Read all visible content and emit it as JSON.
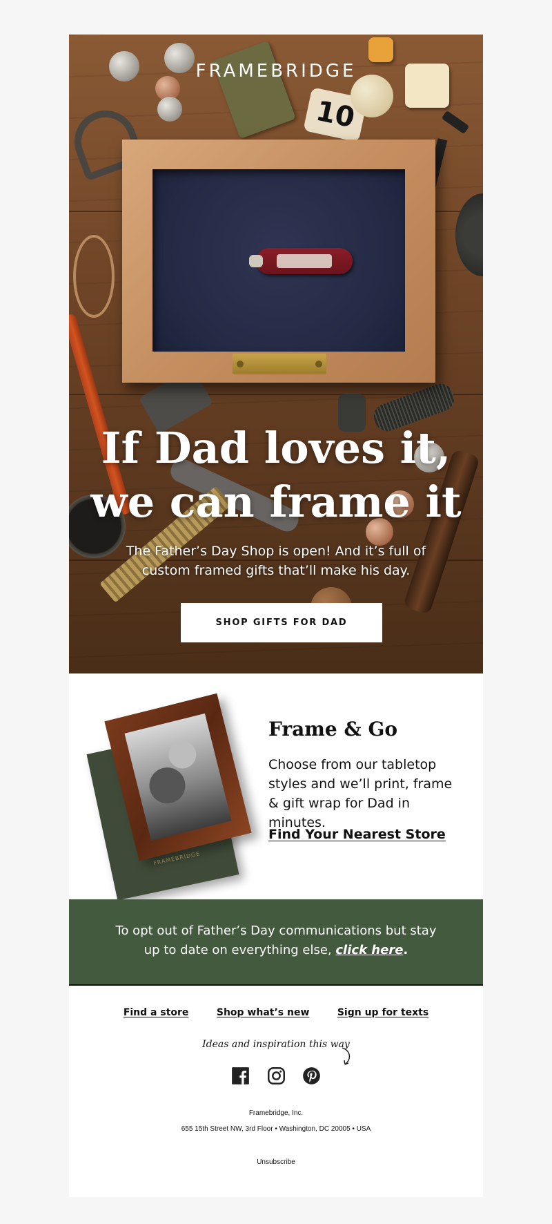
{
  "hero": {
    "logo": "FRAMEBRIDGE",
    "tag_number": "10",
    "headline_line1": "If Dad loves it,",
    "headline_line2": "we can frame it",
    "subtext": "The Father’s Day Shop is open! And it’s full of custom framed gifts that’ll make his day.",
    "cta_label": "SHOP GIFTS FOR DAD"
  },
  "frame_and_go": {
    "title": "Frame & Go",
    "body": "Choose from our tabletop styles and we’ll print, frame & gift wrap for Dad in minutes.",
    "link_label": "Find Your Nearest Store",
    "book_brand": "FRAMEBRIDGE"
  },
  "opt_out": {
    "text": "To opt out of Father’s Day communications but stay up to date on everything else,",
    "link_label": "click here",
    "suffix": ".",
    "background": "#435a3e"
  },
  "footer": {
    "links": [
      "Find a store",
      "Shop what’s new",
      "Sign up for texts"
    ],
    "ideas": "Ideas and inspiration this way",
    "social_icons": [
      "facebook-icon",
      "instagram-icon",
      "pinterest-icon"
    ],
    "company": "Framebridge, Inc.",
    "address": "655 15th Street NW, 3rd Floor • Washington, DC 20005 • USA",
    "unsubscribe": "Unsubscribe"
  }
}
